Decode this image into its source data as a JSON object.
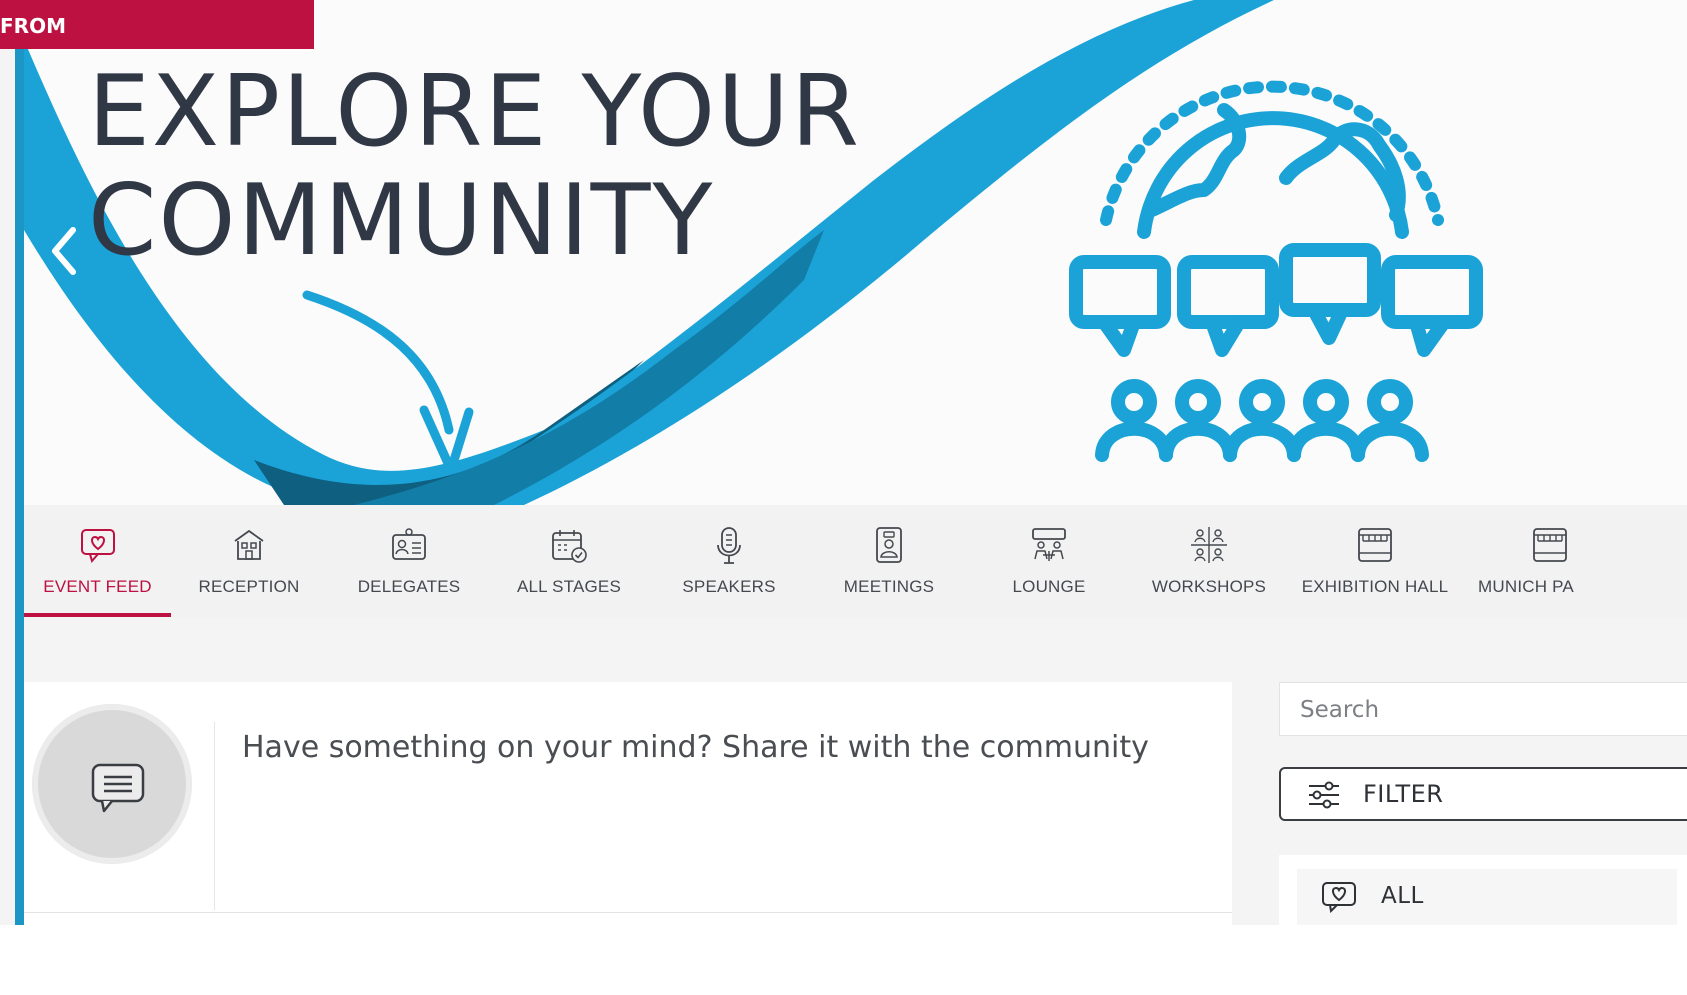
{
  "tag": {
    "label": "FROM"
  },
  "banner": {
    "headline": [
      "EXPLORE YOUR",
      "COMMUNITY"
    ],
    "icons": {
      "prev": "chevron-left-icon",
      "illustration": "globe-community-icon"
    }
  },
  "nav": {
    "items": [
      {
        "label": "EVENT FEED",
        "icon": "heart-chat-icon",
        "active": true
      },
      {
        "label": "RECEPTION",
        "icon": "building-icon"
      },
      {
        "label": "DELEGATES",
        "icon": "id-card-icon"
      },
      {
        "label": "ALL STAGES",
        "icon": "calendar-check-icon"
      },
      {
        "label": "SPEAKERS",
        "icon": "microphone-icon"
      },
      {
        "label": "MEETINGS",
        "icon": "contact-book-icon"
      },
      {
        "label": "LOUNGE",
        "icon": "lounge-table-icon"
      },
      {
        "label": "WORKSHOPS",
        "icon": "workshop-group-icon"
      },
      {
        "label": "EXHIBITION HALL",
        "icon": "exhibition-booth-icon"
      },
      {
        "label": "MUNICH PA",
        "icon": "exhibition-booth-icon"
      }
    ],
    "active_color": "#bd1142"
  },
  "feed": {
    "prompt": "Have something on your mind? Share it with the community",
    "avatar_icon": "message-bubble-icon"
  },
  "sidebar": {
    "search": {
      "placeholder": "Search",
      "value": ""
    },
    "filter": {
      "label": "FILTER",
      "icon": "sliders-icon"
    },
    "all": {
      "label": "ALL",
      "icon": "heart-chat-icon"
    }
  },
  "colors": {
    "accent": "#bd1142",
    "brand_blue": "#1ba3d7",
    "rail": "#1c96c4"
  }
}
